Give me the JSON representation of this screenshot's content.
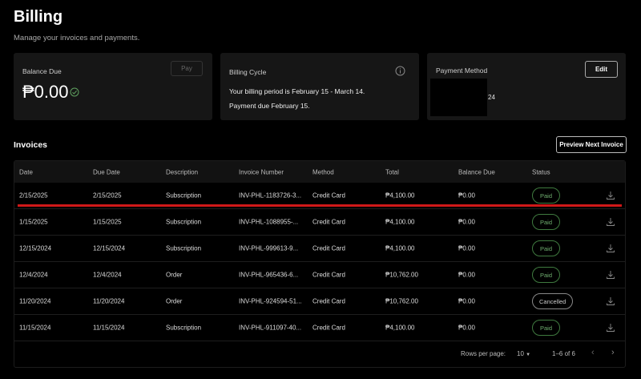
{
  "header": {
    "title": "Billing",
    "subtitle": "Manage your invoices and payments."
  },
  "balance": {
    "label": "Balance Due",
    "amount": "₱0.00",
    "pay_label": "Pay"
  },
  "cycle": {
    "label": "Billing Cycle",
    "line1": "Your billing period is February 15 - March 14.",
    "line2": "Payment due February 15."
  },
  "payment": {
    "label": "Payment Method",
    "card_suffix": "24",
    "edit_label": "Edit"
  },
  "invoices": {
    "title": "Invoices",
    "preview_label": "Preview Next Invoice",
    "columns": [
      "Date",
      "Due Date",
      "Description",
      "Invoice Number",
      "Method",
      "Total",
      "Balance Due",
      "Status"
    ],
    "rows": [
      [
        "2/15/2025",
        "2/15/2025",
        "Subscription",
        "INV-PHL-1183726-3...",
        "Credit Card",
        "₱4,100.00",
        "₱0.00",
        "Paid"
      ],
      [
        "1/15/2025",
        "1/15/2025",
        "Subscription",
        "INV-PHL-1088955-...",
        "Credit Card",
        "₱4,100.00",
        "₱0.00",
        "Paid"
      ],
      [
        "12/15/2024",
        "12/15/2024",
        "Subscription",
        "INV-PHL-999613-9...",
        "Credit Card",
        "₱4,100.00",
        "₱0.00",
        "Paid"
      ],
      [
        "12/4/2024",
        "12/4/2024",
        "Order",
        "INV-PHL-965436-6...",
        "Credit Card",
        "₱10,762.00",
        "₱0.00",
        "Paid"
      ],
      [
        "11/20/2024",
        "11/20/2024",
        "Order",
        "INV-PHL-924594-51...",
        "Credit Card",
        "₱10,762.00",
        "₱0.00",
        "Cancelled"
      ],
      [
        "11/15/2024",
        "11/15/2024",
        "Subscription",
        "INV-PHL-911097-40...",
        "Credit Card",
        "₱4,100.00",
        "₱0.00",
        "Paid"
      ]
    ]
  },
  "pagination": {
    "rows_per_page_label": "Rows per page:",
    "rows_per_page": "10",
    "range": "1–6 of 6"
  },
  "colors": {
    "paid": "#6fae6f",
    "highlight": "#d01818",
    "success": "#5fa05f"
  }
}
